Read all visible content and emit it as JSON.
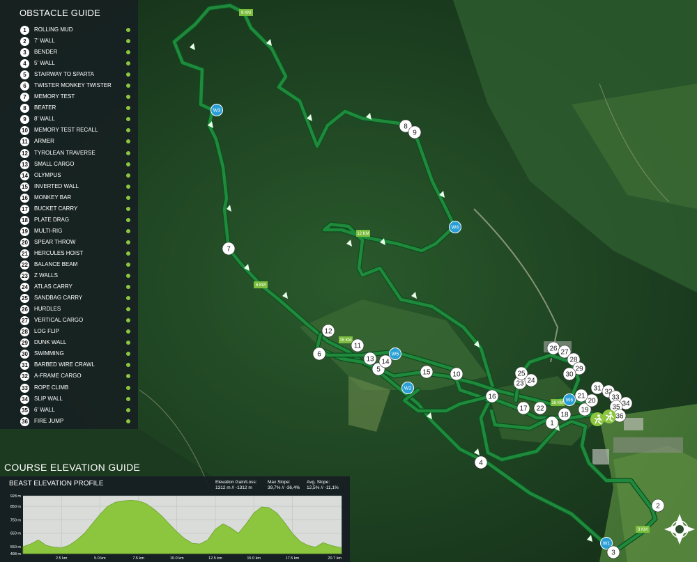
{
  "guide": {
    "title": "OBSTACLE GUIDE",
    "obstacles": [
      {
        "n": "1",
        "label": "ROLLING MUD"
      },
      {
        "n": "2",
        "label": "7' WALL"
      },
      {
        "n": "3",
        "label": "BENDER"
      },
      {
        "n": "4",
        "label": "5' WALL"
      },
      {
        "n": "5",
        "label": "STAIRWAY TO SPARTA"
      },
      {
        "n": "6",
        "label": "TWISTER MONKEY TWISTER"
      },
      {
        "n": "7",
        "label": "MEMORY TEST"
      },
      {
        "n": "8",
        "label": "BEATER"
      },
      {
        "n": "9",
        "label": "8' WALL"
      },
      {
        "n": "10",
        "label": "MEMORY TEST RECALL"
      },
      {
        "n": "11",
        "label": "ARMER"
      },
      {
        "n": "12",
        "label": "TYROLEAN TRAVERSE"
      },
      {
        "n": "13",
        "label": "SMALL CARGO"
      },
      {
        "n": "14",
        "label": "OLYMPUS"
      },
      {
        "n": "15",
        "label": "INVERTED WALL"
      },
      {
        "n": "16",
        "label": "MONKEY BAR"
      },
      {
        "n": "17",
        "label": "BUCKET CARRY"
      },
      {
        "n": "18",
        "label": "PLATE DRAG"
      },
      {
        "n": "19",
        "label": "MULTI-RIG"
      },
      {
        "n": "20",
        "label": "SPEAR THROW"
      },
      {
        "n": "21",
        "label": "HERCULES HOIST"
      },
      {
        "n": "22",
        "label": "BALANCE BEAM"
      },
      {
        "n": "23",
        "label": "Z WALLS"
      },
      {
        "n": "24",
        "label": "ATLAS CARRY"
      },
      {
        "n": "25",
        "label": "SANDBAG CARRY"
      },
      {
        "n": "26",
        "label": "HURDLES"
      },
      {
        "n": "27",
        "label": "VERTICAL CARGO"
      },
      {
        "n": "28",
        "label": "LOG FLIP"
      },
      {
        "n": "29",
        "label": "DUNK WALL"
      },
      {
        "n": "30",
        "label": "SWIMMING"
      },
      {
        "n": "31",
        "label": "BARBED WIRE CRAWL"
      },
      {
        "n": "32",
        "label": "A-FRAME CARGO"
      },
      {
        "n": "33",
        "label": "ROPE CLIMB"
      },
      {
        "n": "34",
        "label": "SLIP WALL"
      },
      {
        "n": "35",
        "label": "6' WALL"
      },
      {
        "n": "36",
        "label": "FIRE JUMP"
      }
    ]
  },
  "map": {
    "km_markers": [
      "9 KM",
      "12 KM",
      "6 KM",
      "15 KM",
      "18 KM",
      "3 KM"
    ],
    "water_stations": [
      "W1",
      "W2",
      "W3",
      "W4",
      "W5",
      "W6"
    ],
    "colors": {
      "route": "#1f8a3b",
      "route_edge": "#0d4d1f",
      "water": "#2a9fd6",
      "marker": "#ffffff",
      "km_tag": "#7cbd3d",
      "accent": "#8cc63f"
    },
    "icons": [
      "runner-icon",
      "finish-runner-icon",
      "compass-icon"
    ]
  },
  "elevation": {
    "section_title": "COURSE ELEVATION GUIDE",
    "profile_title": "BEAST ELEVATION PROFILE",
    "stats": [
      {
        "label": "Elevation Gain/Loss:",
        "value": "1312 m // -1312 m"
      },
      {
        "label": "Max Slope:",
        "value": "39,7% // -36,4%"
      },
      {
        "label": "Avg. Slope:",
        "value": "12,5% // -11,1%"
      }
    ],
    "chart_data": {
      "type": "area",
      "title": "BEAST ELEVATION PROFILE",
      "xlabel": "",
      "ylabel": "",
      "x_ticks": [
        "2.5 km",
        "5.0 km",
        "7.5 km",
        "10.0 km",
        "12.5 km",
        "15.0 km",
        "17.5 km",
        "20.7 km"
      ],
      "y_ticks": [
        "928 m",
        "850 m",
        "750 m",
        "650 m",
        "550 m",
        "498 m"
      ],
      "xlim": [
        0,
        20.7
      ],
      "ylim": [
        498,
        928
      ],
      "series": [
        {
          "x": [
            0,
            0.5,
            1.0,
            1.5,
            2.0,
            2.5,
            3.0,
            3.5,
            4.0,
            4.5,
            5.0,
            5.5,
            6.0,
            6.5,
            7.0,
            7.5,
            8.0,
            8.5,
            9.0,
            9.5,
            10.0,
            10.5,
            11.0,
            11.5,
            12.0,
            12.5,
            13.0,
            13.5,
            14.0,
            14.5,
            15.0,
            15.5,
            16.0,
            16.5,
            17.0,
            17.5,
            18.0,
            18.5,
            19.0,
            19.5,
            20.0,
            20.7
          ],
          "y": [
            550,
            570,
            600,
            560,
            545,
            540,
            560,
            600,
            650,
            720,
            790,
            850,
            880,
            890,
            895,
            890,
            870,
            830,
            780,
            720,
            660,
            610,
            575,
            570,
            600,
            680,
            720,
            690,
            650,
            720,
            800,
            845,
            840,
            800,
            730,
            650,
            590,
            560,
            545,
            580,
            560,
            540
          ]
        }
      ]
    }
  }
}
